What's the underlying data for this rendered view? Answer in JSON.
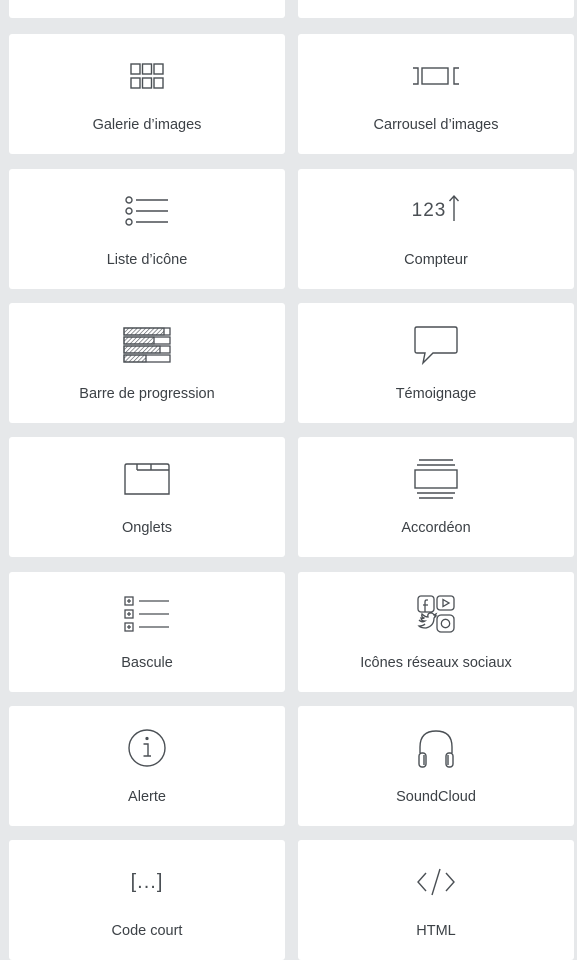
{
  "widgets": [
    {
      "label": "Galerie d’images",
      "icon": "image-gallery-icon"
    },
    {
      "label": "Carrousel d’images",
      "icon": "image-carousel-icon"
    },
    {
      "label": "Liste d’icône",
      "icon": "icon-list-icon"
    },
    {
      "label": "Compteur",
      "icon": "counter-icon",
      "icon_text": "123"
    },
    {
      "label": "Barre de progression",
      "icon": "progress-bar-icon"
    },
    {
      "label": "Témoignage",
      "icon": "testimonial-icon"
    },
    {
      "label": "Onglets",
      "icon": "tabs-icon"
    },
    {
      "label": "Accordéon",
      "icon": "accordion-icon"
    },
    {
      "label": "Bascule",
      "icon": "toggle-icon"
    },
    {
      "label": "Icônes réseaux sociaux",
      "icon": "social-icons-icon"
    },
    {
      "label": "Alerte",
      "icon": "alert-icon"
    },
    {
      "label": "SoundCloud",
      "icon": "soundcloud-icon"
    },
    {
      "label": "Code court",
      "icon": "shortcode-icon",
      "icon_text": "[...]"
    },
    {
      "label": "HTML",
      "icon": "html-icon"
    }
  ],
  "colors": {
    "background": "#e6e8ea",
    "card": "#ffffff",
    "icon": "#4a4f54",
    "text": "#3c4146"
  }
}
